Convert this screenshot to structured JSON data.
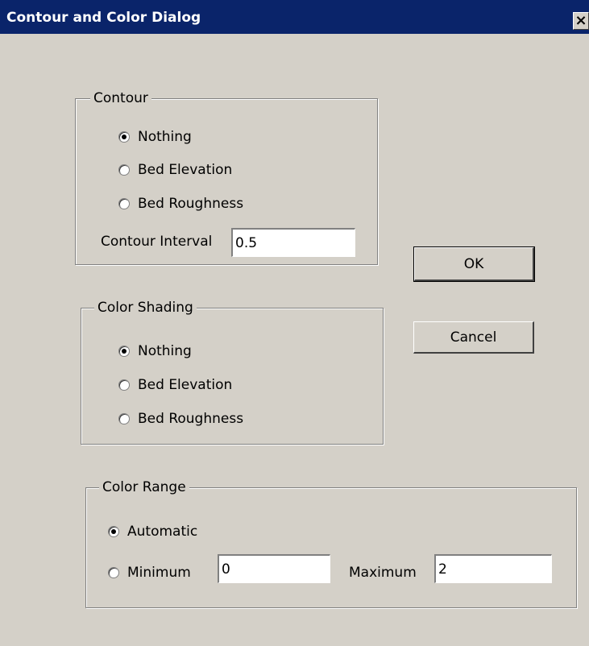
{
  "window": {
    "title": "Contour and Color Dialog",
    "close_glyph": "×",
    "close_icon": "close-icon"
  },
  "contour": {
    "legend": "Contour",
    "options": [
      {
        "label": "Nothing",
        "selected": true
      },
      {
        "label": "Bed Elevation",
        "selected": false
      },
      {
        "label": "Bed Roughness",
        "selected": false
      }
    ],
    "interval_label": "Contour Interval",
    "interval_value": "0.5"
  },
  "color_shading": {
    "legend": "Color Shading",
    "options": [
      {
        "label": "Nothing",
        "selected": true
      },
      {
        "label": "Bed Elevation",
        "selected": false
      },
      {
        "label": "Bed Roughness",
        "selected": false
      }
    ]
  },
  "color_range": {
    "legend": "Color Range",
    "automatic_label": "Automatic",
    "automatic_selected": true,
    "minimum_label": "Minimum",
    "minimum_selected": false,
    "minimum_value": "0",
    "maximum_label": "Maximum",
    "maximum_value": "2"
  },
  "buttons": {
    "ok": "OK",
    "cancel": "Cancel"
  }
}
